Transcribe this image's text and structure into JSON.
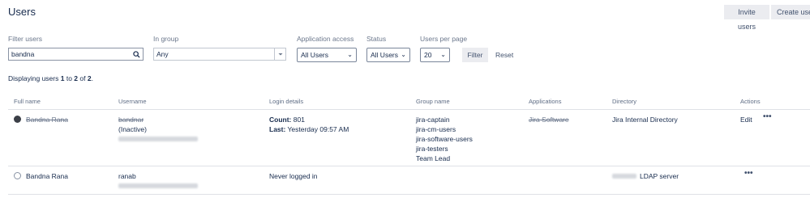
{
  "header": {
    "title": "Users",
    "invite_label": "Invite users",
    "create_label": "Create user"
  },
  "filters": {
    "filter_users_label": "Filter users",
    "filter_users_value": "bandna",
    "in_group_label": "In group",
    "in_group_value": "Any",
    "app_access_label": "Application access",
    "app_access_value": "All Users",
    "status_label": "Status",
    "status_value": "All Users",
    "per_page_label": "Users per page",
    "per_page_value": "20",
    "filter_button": "Filter",
    "reset_link": "Reset"
  },
  "summary": {
    "prefix": "Displaying users ",
    "from": "1",
    "mid": " to ",
    "to": "2",
    "of": " of ",
    "total": "2",
    "suffix": "."
  },
  "columns": {
    "full_name": "Full name",
    "username": "Username",
    "login": "Login details",
    "group": "Group name",
    "applications": "Applications",
    "directory": "Directory",
    "actions": "Actions"
  },
  "rows": [
    {
      "full_name": "Bandna Rana",
      "username": "bandnar",
      "username_status": "(Inactive)",
      "count_label": "Count:",
      "count_value": " 801",
      "last_label": "Last:",
      "last_value": " Yesterday 09:57 AM",
      "groups": [
        "jira-captain",
        "jira-cm-users",
        "jira-software-users",
        "jira-testers",
        "Team Lead"
      ],
      "application": "Jira Software",
      "directory": "Jira Internal Directory",
      "edit_label": "Edit",
      "more": "•••"
    },
    {
      "full_name": "Bandna Rana",
      "username": "ranab",
      "login": "Never logged in",
      "directory": "LDAP server",
      "more": "•••"
    }
  ],
  "icons": {
    "search": "search-icon",
    "chevron": "chevron-down-icon",
    "avatar": "user-avatar-icon",
    "more": "more-actions-icon"
  }
}
